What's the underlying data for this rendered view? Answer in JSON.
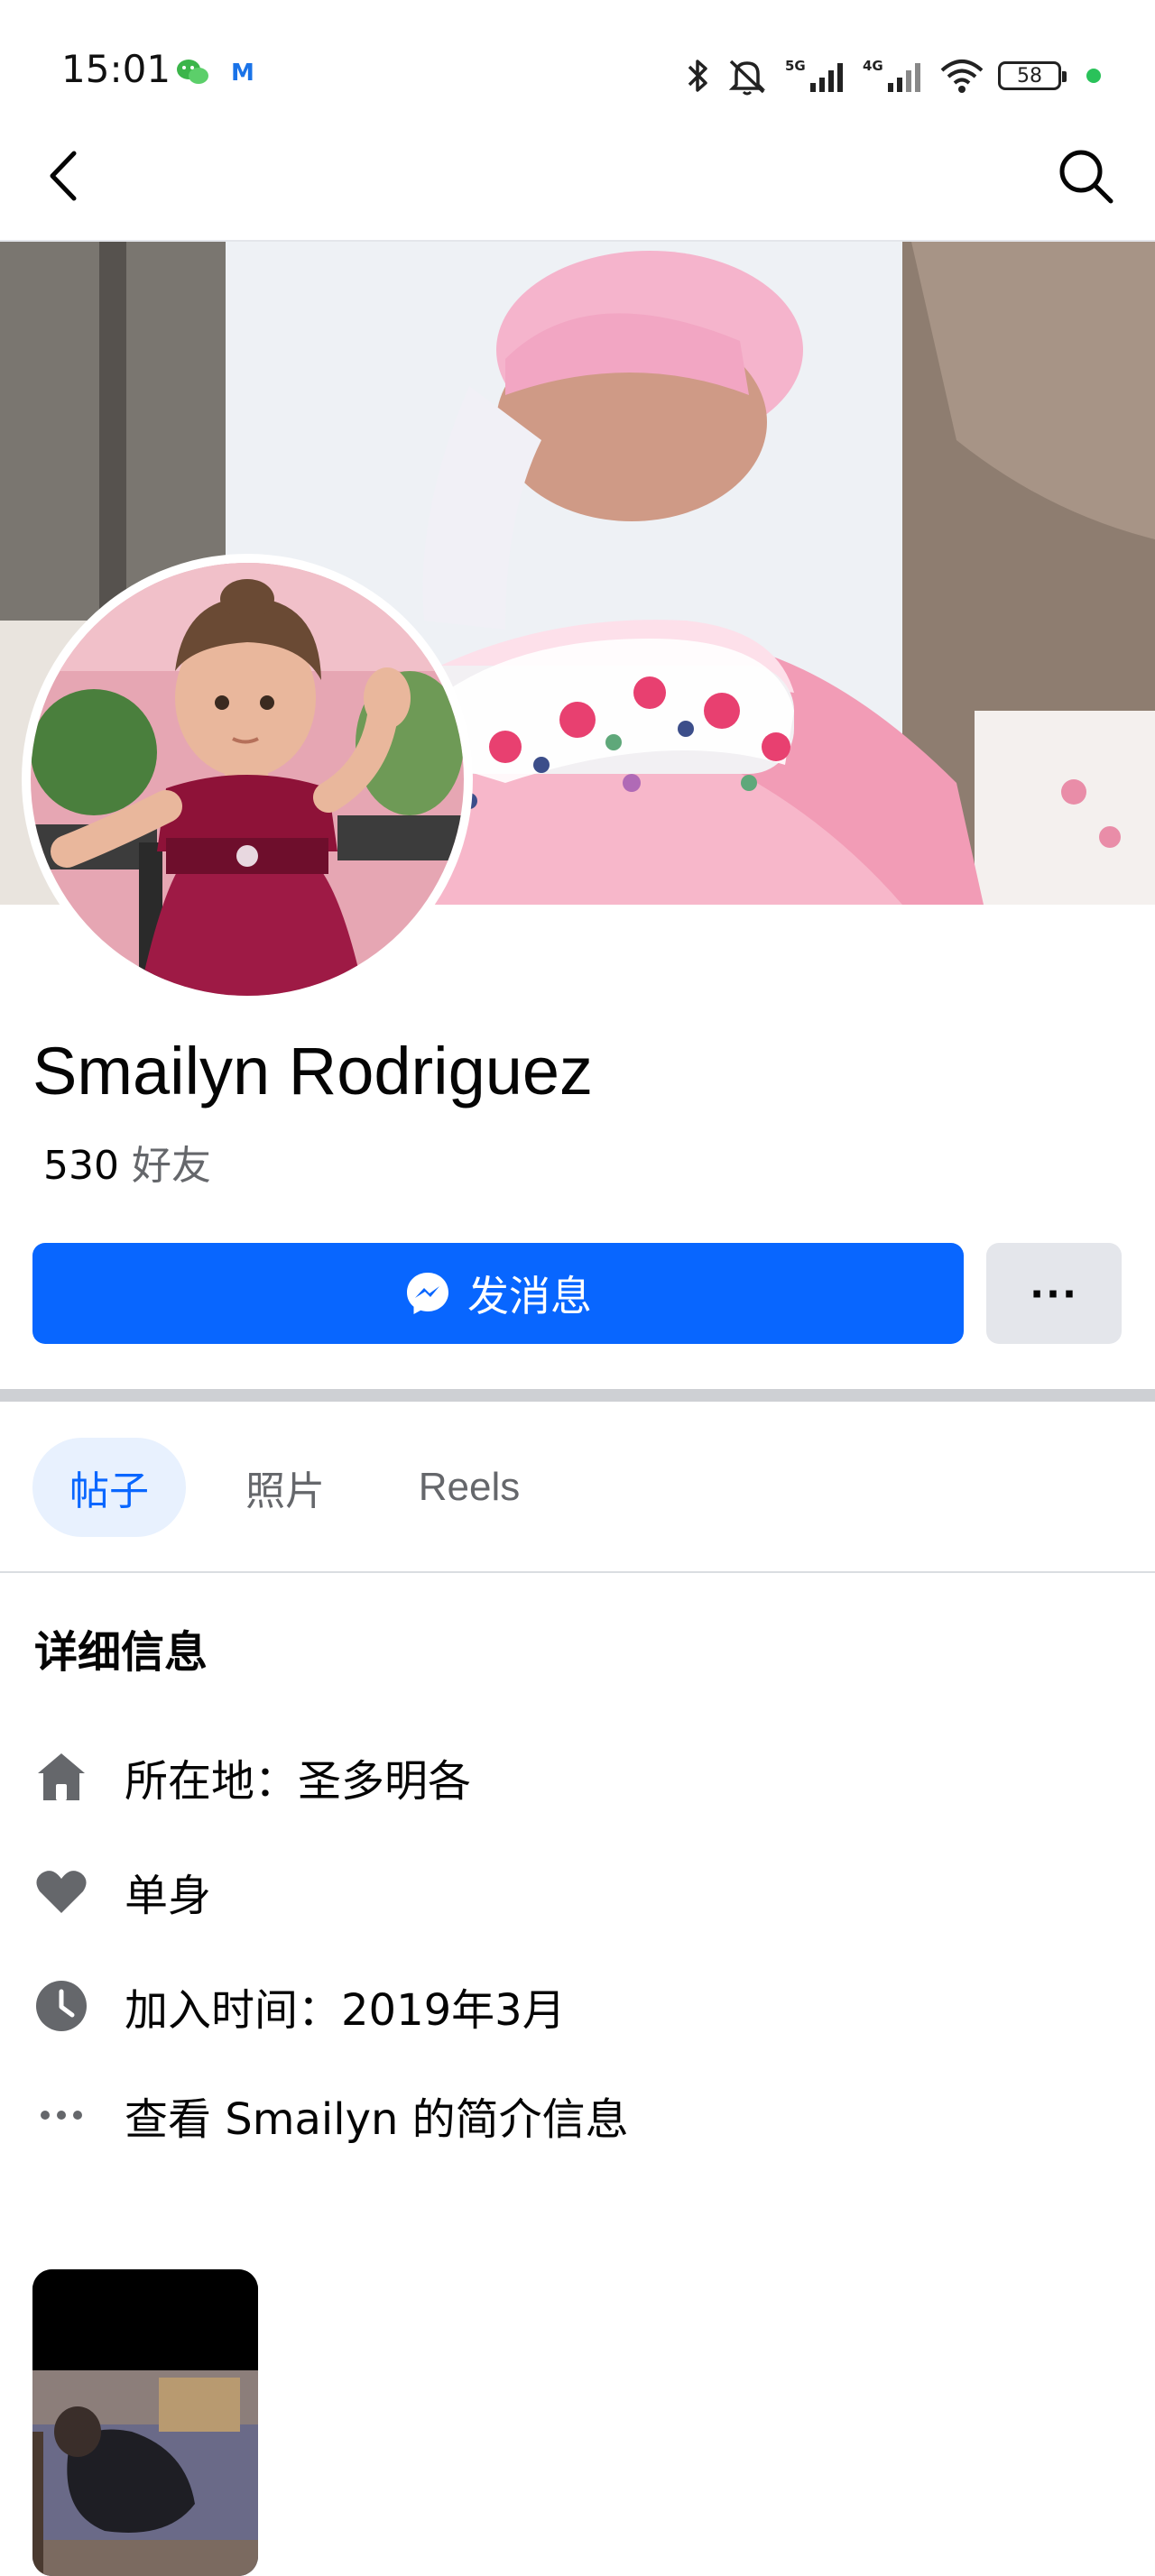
{
  "status_bar": {
    "time": "15:01",
    "mail_glyph": "M",
    "battery": "58"
  },
  "nav": {
    "back_icon": "chevron-left-icon",
    "search_icon": "search-icon"
  },
  "profile": {
    "name": "Smailyn Rodriguez",
    "friends_count": "530",
    "friends_label": "好友"
  },
  "actions": {
    "message_label": "发消息",
    "more_label": "···"
  },
  "tabs": [
    {
      "label": "帖子",
      "active": true
    },
    {
      "label": "照片",
      "active": false
    },
    {
      "label": "Reels",
      "active": false
    }
  ],
  "details": {
    "title": "详细信息",
    "items": [
      {
        "icon": "home-icon",
        "text": "所在地：圣多明各"
      },
      {
        "icon": "heart-icon",
        "text": "单身"
      },
      {
        "icon": "clock-icon",
        "text": "加入时间：2019年3月"
      },
      {
        "icon": "more-dots-icon",
        "text": "查看 Smailyn 的简介信息"
      }
    ]
  },
  "colors": {
    "accent": "#0866ff",
    "secondary_text": "#65676b",
    "icon_gray": "#65676b"
  }
}
